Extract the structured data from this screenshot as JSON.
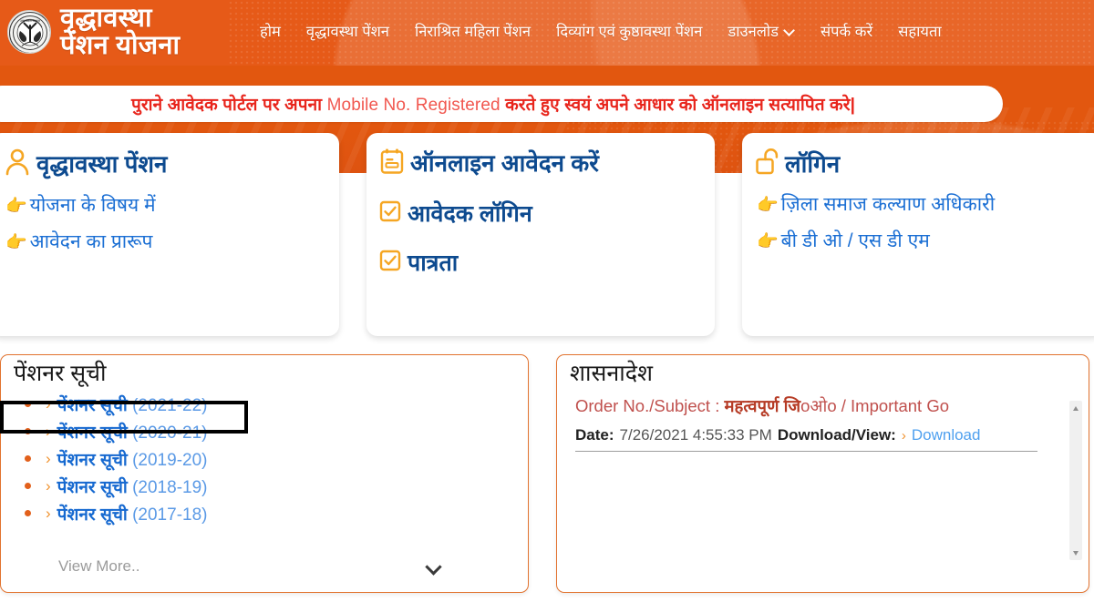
{
  "header": {
    "emblem_alt": "uttar-pradesh-government-emblem",
    "brand_line1": "वृद्धावस्था",
    "brand_line2": "पेंशन योजना",
    "nav": [
      {
        "label": "होम",
        "has_caret": false
      },
      {
        "label": "वृद्धावस्था पेंशन",
        "has_caret": false
      },
      {
        "label": "निराश्रित महिला पेंशन",
        "has_caret": false
      },
      {
        "label": "दिव्यांग एवं कुष्ठावस्था पेंशन",
        "has_caret": false
      },
      {
        "label": "डाउनलोड",
        "has_caret": true
      },
      {
        "label": "संपर्क करें",
        "has_caret": false
      },
      {
        "label": "सहायता",
        "has_caret": false
      }
    ]
  },
  "marquee": {
    "part1": "पुराने आवेदक पोर्टल पर अपना ",
    "part2": "Mobile No. Registered ",
    "part3": "करते हुए स्वयं अपने आधार को ऑनलाइन सत्यापित करे|"
  },
  "cards": [
    {
      "icon": "person-icon",
      "title": "वृद्धावस्था पेंशन",
      "links": [
        {
          "icon": "pointing-hand-icon",
          "label": "योजना के विषय में"
        },
        {
          "icon": "pointing-hand-icon",
          "label": "आवेदन का प्रारूप"
        }
      ]
    },
    {
      "icon": "clipboard-form-icon",
      "title": "ऑनलाइन आवेदन करें",
      "rows": [
        {
          "icon": "checkbox-checked-icon",
          "label": "आवेदक लॉगिन"
        },
        {
          "icon": "checkbox-checked-icon",
          "label": "पात्रता"
        }
      ]
    },
    {
      "icon": "open-padlock-icon",
      "title": "लॉगिन",
      "links": [
        {
          "icon": "pointing-hand-icon",
          "label": "ज़िला समाज कल्याण अधिकारी"
        },
        {
          "icon": "pointing-hand-icon",
          "label": "बी डी ओ / एस डी एम"
        }
      ]
    }
  ],
  "pensioner_panel": {
    "title": "पेंशनर सूची",
    "items": [
      {
        "name": "पेंशनर सूची ",
        "year": "(2021-22)",
        "focused": true
      },
      {
        "name": "पेंशनर सूची ",
        "year": "(2020-21)",
        "focused": false
      },
      {
        "name": "पेंशनर सूची ",
        "year": "(2019-20)",
        "focused": false
      },
      {
        "name": "पेंशनर सूची ",
        "year": "(2018-19)",
        "focused": false
      },
      {
        "name": "पेंशनर सूची ",
        "year": "(2017-18)",
        "focused": false
      }
    ],
    "view_more": "View More.."
  },
  "order_panel": {
    "title": "शासनादेश",
    "order_label": "Order No./Subject : ",
    "order_subject_hi": "महत्वपूर्ण जि",
    "order_subject_hi2": "oओo",
    "order_subject_en": " / Important Go",
    "date_label": "Date:",
    "date_value": "7/26/2021 4:55:33 PM",
    "download_label": "Download/View:",
    "download_link": "Download"
  },
  "colors": {
    "brand_orange": "#e2570f",
    "nav_orange": "#e65a18",
    "icon_yellow": "#f5a623",
    "link_blue": "#1b6fd4",
    "title_blue": "#0d4a8f",
    "marquee_red": "#e8251c",
    "panel_border": "#e2732f"
  }
}
